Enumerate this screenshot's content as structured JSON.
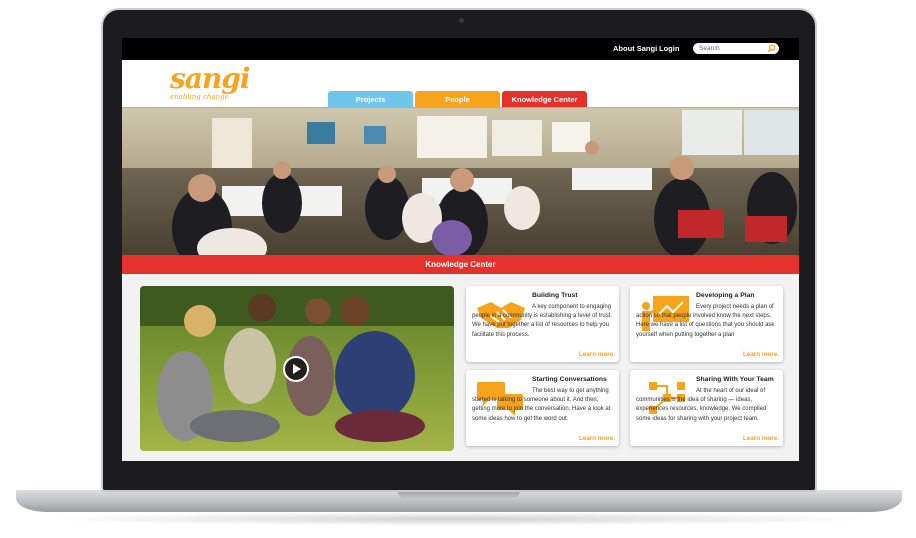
{
  "topbar": {
    "about_link": "About Sangi",
    "login_link": "Login",
    "search_placeholder": "Search"
  },
  "logo": {
    "name": "sangi",
    "tagline": "enabling change"
  },
  "tabs": [
    {
      "label": "Projects",
      "color": "#6ec6ea"
    },
    {
      "label": "People",
      "color": "#f7a31b"
    },
    {
      "label": "Knowledge Center",
      "color": "#e4312b"
    }
  ],
  "banner": {
    "title": "Knowledge Center"
  },
  "cards": [
    {
      "title": "Building Trust",
      "icon": "handshake-icon",
      "body": "A key component to engaging people in a community is establishing a level of trust. We have put together a list of resources to help you facilitate this process.",
      "more": "Learn more."
    },
    {
      "title": "Developing a Plan",
      "icon": "presenter-board-icon",
      "body": "Every project needs a plan of action so that people involved know the next steps. Here we have a list of questions that you should ask yourself when putting together a plan",
      "more": "Learn more."
    },
    {
      "title": "Starting Conversations",
      "icon": "speech-bubbles-icon",
      "body": "The best way to get anything started is talking to someone about it. And then, getting more to join the conversation. Have a look at some ideas how to get the word out.",
      "more": "Learn more."
    },
    {
      "title": "Sharing With Your Team",
      "icon": "network-icon",
      "body": "At the heart of our ideal of communities is the idea of sharing — ideas, experiences resources, knowledge. We compiled some ideas for sharing with your project team.",
      "more": "Learn more."
    }
  ],
  "colors": {
    "orange": "#f7a31b",
    "red": "#e4312b",
    "blue": "#6ec6ea"
  }
}
